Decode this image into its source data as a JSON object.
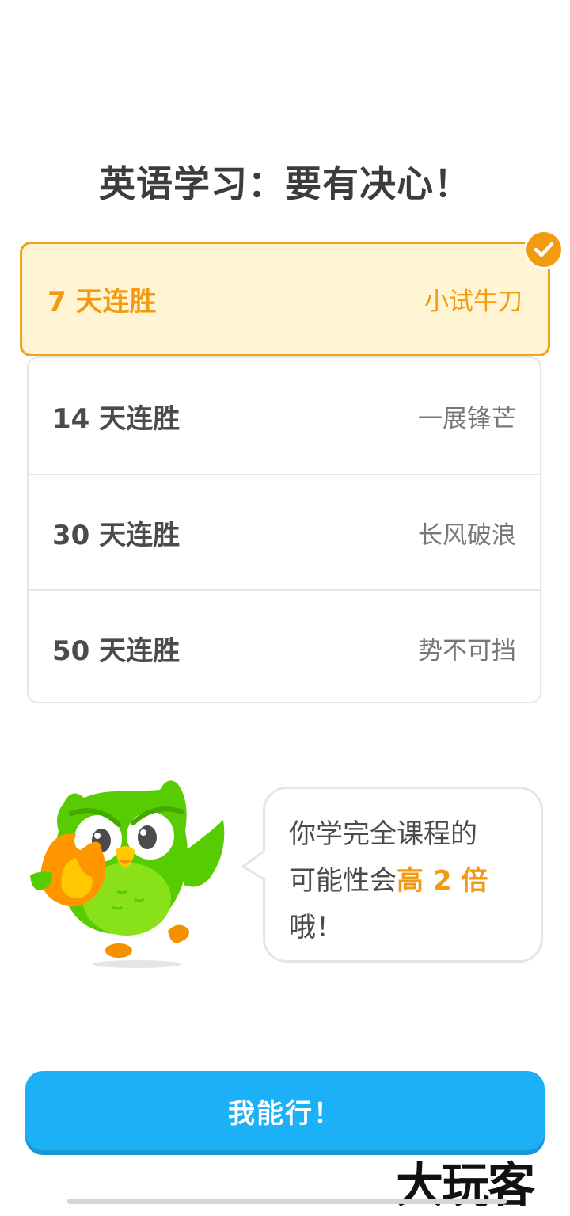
{
  "title": "英语学习：要有决心！",
  "goals": [
    {
      "goal": "7 天连胜",
      "level": "小试牛刀",
      "selected": true
    },
    {
      "goal": "14 天连胜",
      "level": "一展锋芒",
      "selected": false
    },
    {
      "goal": "30 天连胜",
      "level": "长风破浪",
      "selected": false
    },
    {
      "goal": "50 天连胜",
      "level": "势不可挡",
      "selected": false
    }
  ],
  "bubble": {
    "line1": "你学完全课程的",
    "line2_pre": "可能性会",
    "line2_highlight": "高 2 倍",
    "line3": "哦！"
  },
  "cta_label": "我能行！",
  "watermark": "大玩客",
  "colors": {
    "accent_orange": "#f29b10",
    "selected_bg": "#fff4d3",
    "button_blue": "#1cb0f6",
    "owl_green": "#58cc02"
  },
  "icons": {
    "check": "check-icon",
    "mascot": "owl-mascot-icon"
  }
}
